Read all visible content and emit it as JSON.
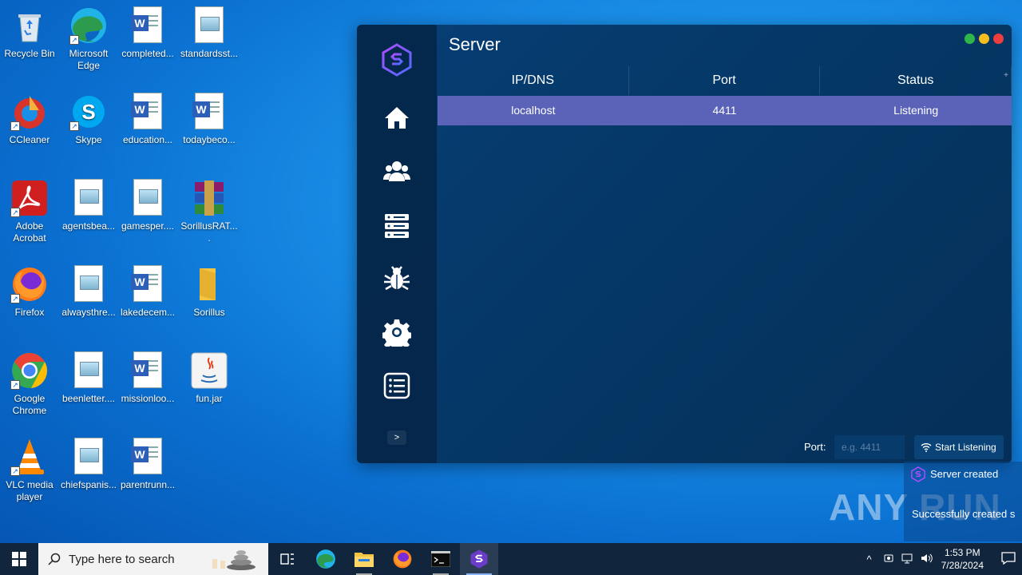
{
  "desktop": {
    "icons": [
      {
        "label": "Recycle Bin",
        "icon": "recycle-bin-icon"
      },
      {
        "label": "Microsoft Edge",
        "icon": "edge-icon"
      },
      {
        "label": "completed...",
        "icon": "word-doc-icon"
      },
      {
        "label": "standardsst...",
        "icon": "image-file-icon"
      },
      {
        "label": "CCleaner",
        "icon": "ccleaner-icon"
      },
      {
        "label": "Skype",
        "icon": "skype-icon"
      },
      {
        "label": "education...",
        "icon": "word-doc-icon"
      },
      {
        "label": "todaybeco...",
        "icon": "word-doc-icon"
      },
      {
        "label": "Adobe Acrobat",
        "icon": "acrobat-icon"
      },
      {
        "label": "agentsbea...",
        "icon": "image-file-icon"
      },
      {
        "label": "gamesper....",
        "icon": "image-file-icon"
      },
      {
        "label": "SorillusRAT....",
        "icon": "winrar-icon"
      },
      {
        "label": "Firefox",
        "icon": "firefox-icon"
      },
      {
        "label": "alwaysthre...",
        "icon": "image-file-icon"
      },
      {
        "label": "lakedecem...",
        "icon": "word-doc-icon"
      },
      {
        "label": "Sorillus",
        "icon": "folder-icon"
      },
      {
        "label": "Google Chrome",
        "icon": "chrome-icon"
      },
      {
        "label": "beenletter....",
        "icon": "image-file-icon"
      },
      {
        "label": "missionloo...",
        "icon": "word-doc-icon"
      },
      {
        "label": "fun.jar",
        "icon": "java-icon"
      },
      {
        "label": "VLC media player",
        "icon": "vlc-icon"
      },
      {
        "label": "chiefspanis...",
        "icon": "image-file-icon"
      },
      {
        "label": "parentrunn...",
        "icon": "word-doc-icon"
      }
    ]
  },
  "app": {
    "title": "Server",
    "columns": [
      "IP/DNS",
      "Port",
      "Status"
    ],
    "add_column_symbol": "+",
    "rows": [
      {
        "ip": "localhost",
        "port": "4411",
        "status": "Listening"
      }
    ],
    "port_label": "Port:",
    "port_placeholder": "e.g. 4411",
    "start_button": "Start Listening",
    "expand_symbol": ">",
    "colors": {
      "row_selected": "#5a63b8",
      "accent": "#8a4dff"
    }
  },
  "toast": {
    "title": "Server created",
    "message": "Successfully created s"
  },
  "watermark": "ANY RUN",
  "taskbar": {
    "search_placeholder": "Type here to search",
    "time": "1:53 PM",
    "date": "7/28/2024"
  }
}
